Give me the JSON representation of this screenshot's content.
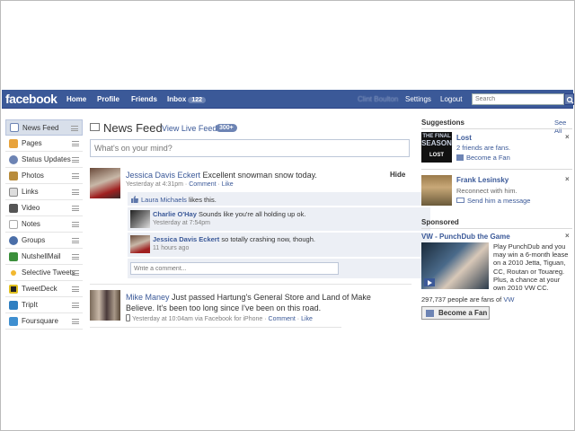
{
  "topbar": {
    "logo": "facebook",
    "nav": [
      "Home",
      "Profile",
      "Friends"
    ],
    "inbox_label": "Inbox",
    "inbox_count": "122",
    "user_name": "Clint Boulton",
    "settings": "Settings",
    "logout": "Logout",
    "search_placeholder": "Search"
  },
  "sidebar": {
    "items": [
      {
        "label": "News Feed",
        "icon": "news-feed-icon",
        "color": "#6d84b4"
      },
      {
        "label": "Pages",
        "icon": "pages-icon",
        "color": "#e8a33c"
      },
      {
        "label": "Status Updates",
        "icon": "status-icon",
        "color": "#6d84b4"
      },
      {
        "label": "Photos",
        "icon": "photos-icon",
        "color": "#b88c3c"
      },
      {
        "label": "Links",
        "icon": "links-icon",
        "color": "#888888"
      },
      {
        "label": "Video",
        "icon": "video-icon",
        "color": "#555555"
      },
      {
        "label": "Notes",
        "icon": "notes-icon",
        "color": "#cccccc"
      },
      {
        "label": "Groups",
        "icon": "groups-icon",
        "color": "#4a6ea8"
      },
      {
        "label": "NutshellMail",
        "icon": "nutshellmail-icon",
        "color": "#3b8f3b"
      },
      {
        "label": "Selective Tweets",
        "icon": "selective-tweets-icon",
        "color": "#f2b830"
      },
      {
        "label": "TweetDeck",
        "icon": "tweetdeck-icon",
        "color": "#e0c020"
      },
      {
        "label": "TripIt",
        "icon": "tripit-icon",
        "color": "#2f7fc1"
      },
      {
        "label": "Foursquare",
        "icon": "foursquare-icon",
        "color": "#3f8fd0"
      }
    ]
  },
  "main": {
    "title": "News Feed",
    "live_feed": "View Live Feed",
    "live_count": "300+",
    "status_placeholder": "What's on your mind?",
    "hide": "Hide",
    "post1": {
      "author": "Jessica Davis Eckert",
      "text": " Excellent snowman snow today.",
      "time": "Yesterday at 4:31pm",
      "comment": "Comment",
      "like": "Like",
      "likes_name": "Laura Michaels",
      "likes_text": " likes this.",
      "comments": [
        {
          "author": "Charlie O'Hay",
          "text": " Sounds like you're all holding up ok.",
          "time": "Yesterday at 7:54pm"
        },
        {
          "author": "Jessica Davis Eckert",
          "text": " so totally crashing now, though.",
          "time": "11 hours ago"
        }
      ],
      "write_placeholder": "Write a comment..."
    },
    "post2": {
      "author": "Mike Maney",
      "line1": " Just passed Hartung's General Store and Land of Make",
      "line2": "Believe. It's been too long since I've been on this road.",
      "time": "Yesterday at 10:04am via Facebook for iPhone",
      "comment": "Comment",
      "like": "Like"
    }
  },
  "right": {
    "suggestions_title": "Suggestions",
    "see_all": "See All",
    "s1": {
      "name": "Lost",
      "sub": "2 friends are fans.",
      "action": "Become a Fan",
      "thumb_text1": "THE FINAL",
      "thumb_text2": "SEASON",
      "thumb_text3": "LOST"
    },
    "s2": {
      "name": "Frank Lesinsky",
      "sub": "Reconnect with him.",
      "action": "Send him a message"
    },
    "sponsored_title": "Sponsored",
    "ad": {
      "title": "VW - PunchDub the Game",
      "body": [
        "Play PunchDub and you",
        "may win a 6-month lease",
        "on a 2010 Jetta, Tiguan,",
        "CC, Routan or Touareg.",
        "Plus, a chance at your",
        "own 2010 VW CC."
      ],
      "fans_text": "297,737 people are fans of ",
      "fans_link": "VW",
      "fan_button": "Become a Fan"
    }
  }
}
